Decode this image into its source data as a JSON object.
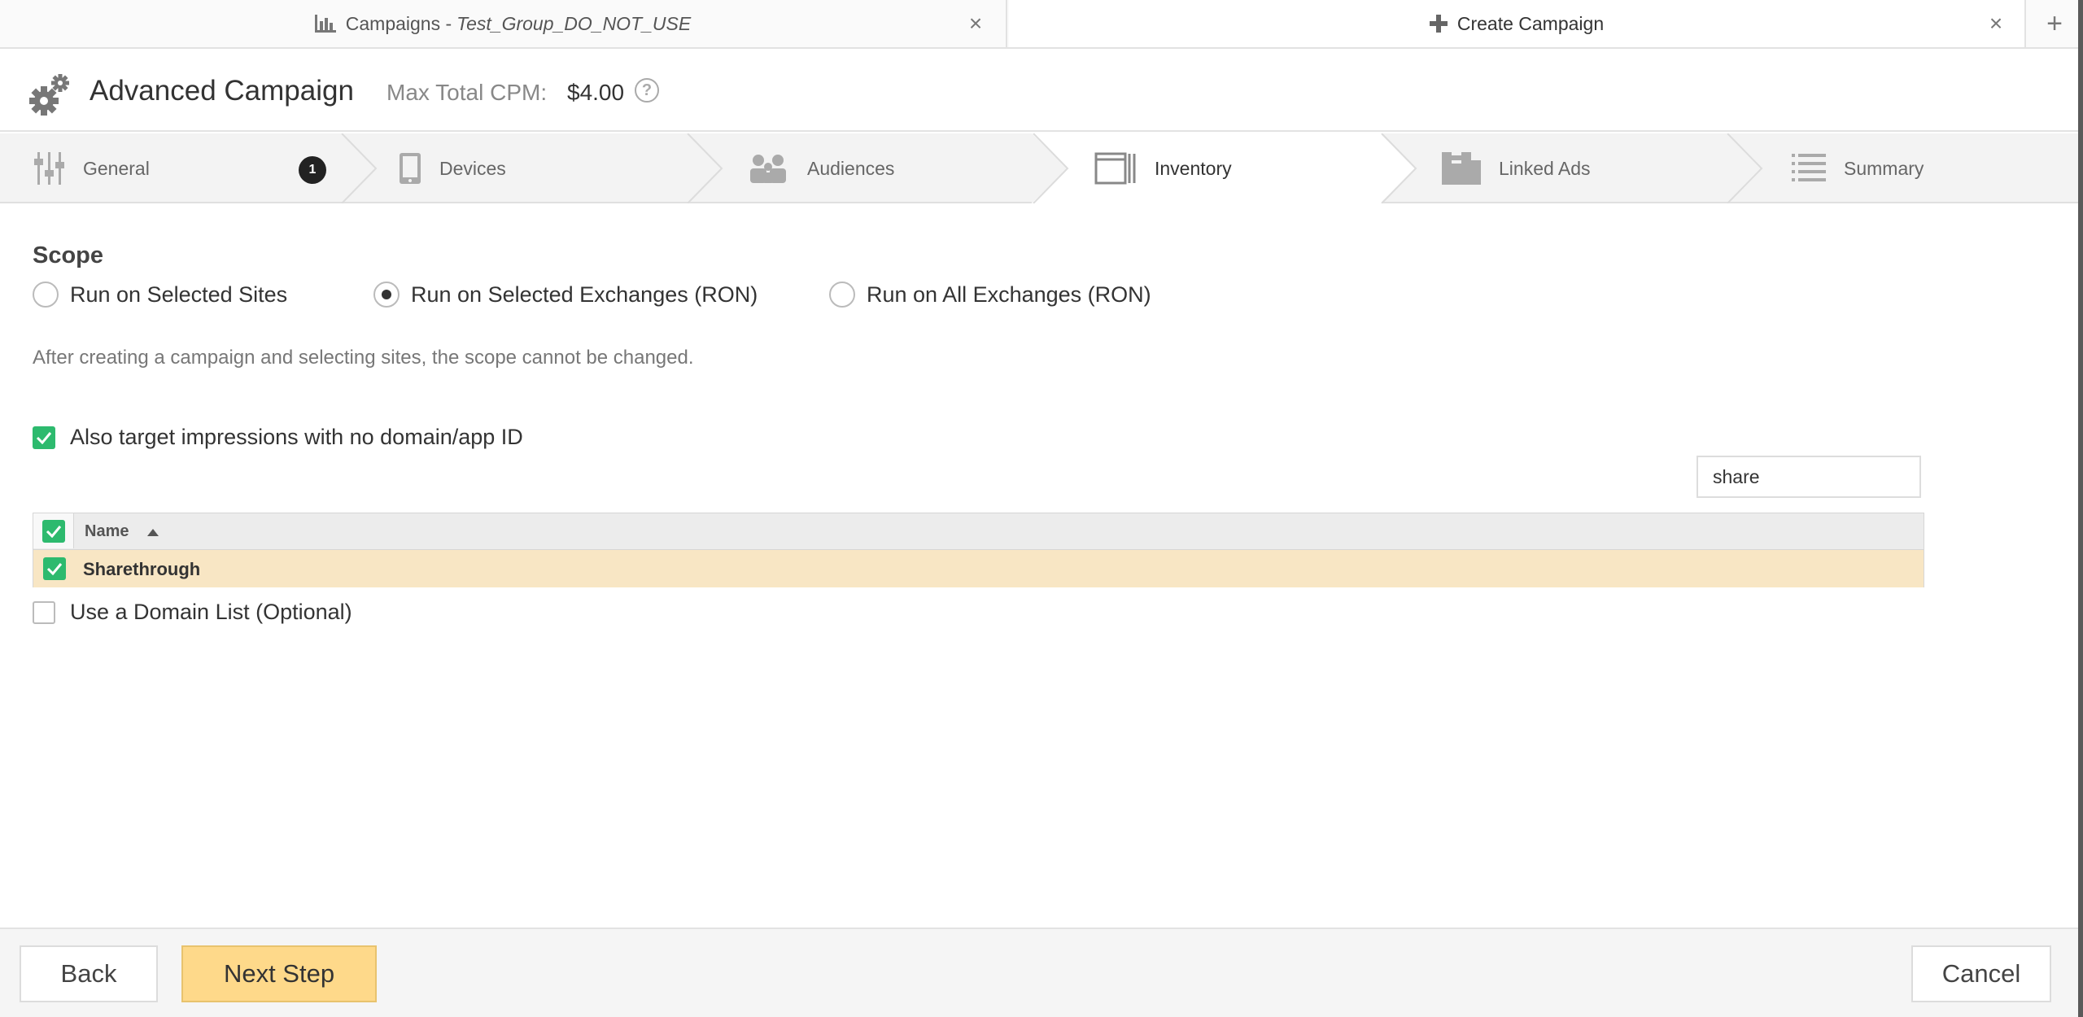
{
  "tabs": [
    {
      "label": "Campaigns - ",
      "sublabel": "Test_Group_DO_NOT_USE",
      "icon": "bar-chart-icon"
    },
    {
      "label": "Create Campaign",
      "icon": "plus-icon"
    }
  ],
  "header": {
    "title": "Advanced Campaign",
    "cpm_label": "Max Total CPM:",
    "cpm_value": "$4.00",
    "help": "?"
  },
  "steps": [
    {
      "label": "General",
      "icon": "sliders-icon",
      "badge": "1"
    },
    {
      "label": "Devices",
      "icon": "phone-icon"
    },
    {
      "label": "Audiences",
      "icon": "people-icon"
    },
    {
      "label": "Inventory",
      "icon": "window-icon",
      "active": true
    },
    {
      "label": "Linked Ads",
      "icon": "blocks-icon"
    },
    {
      "label": "Summary",
      "icon": "list-icon"
    }
  ],
  "scope": {
    "title": "Scope",
    "options": [
      {
        "label": "Run on Selected Sites",
        "selected": false
      },
      {
        "label": "Run on Selected Exchanges (RON)",
        "selected": true
      },
      {
        "label": "Run on All Exchanges (RON)",
        "selected": false
      }
    ],
    "note": "After creating a campaign and selecting sites, the scope cannot be changed."
  },
  "no_domain_checkbox": {
    "label": "Also target impressions with no domain/app ID",
    "checked": true
  },
  "search": {
    "value": "share"
  },
  "grid": {
    "columns": [
      "Name"
    ],
    "rows": [
      {
        "name": "Sharethrough",
        "checked": true
      }
    ]
  },
  "domain_list_checkbox": {
    "label": "Use a Domain List (Optional)",
    "checked": false
  },
  "footer": {
    "back": "Back",
    "next": "Next Step",
    "cancel": "Cancel"
  },
  "colors": {
    "accent_green": "#2dba6e",
    "next_button": "#fed98a",
    "selected_row": "#f8e6c4"
  }
}
